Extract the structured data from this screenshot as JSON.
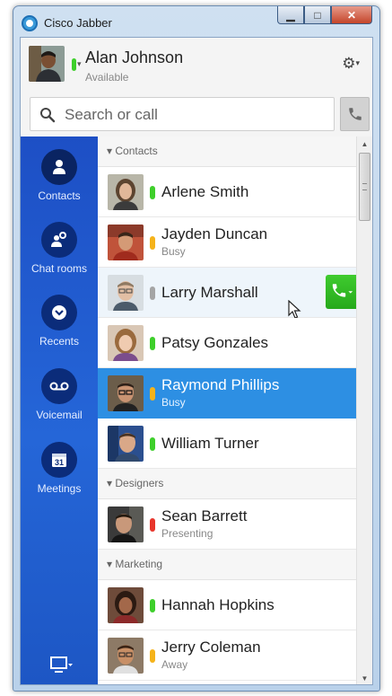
{
  "window": {
    "title": "Cisco Jabber",
    "minimize_icon": "minimize-icon",
    "maximize_icon": "maximize-icon",
    "close_icon": "close-icon"
  },
  "header": {
    "user_name": "Alan Johnson",
    "status": "Available",
    "status_color": "#3ecf2b"
  },
  "search": {
    "placeholder": "Search or call",
    "value": ""
  },
  "sidebar": {
    "items": [
      {
        "label": "Contacts",
        "icon": "person-icon"
      },
      {
        "label": "Chat rooms",
        "icon": "chat-rooms-icon"
      },
      {
        "label": "Recents",
        "icon": "recents-icon"
      },
      {
        "label": "Voicemail",
        "icon": "voicemail-icon"
      },
      {
        "label": "Meetings",
        "icon": "calendar-icon",
        "icon_text": "31"
      }
    ]
  },
  "contacts": {
    "groups": [
      {
        "name": "Contacts"
      },
      {
        "name": "Designers"
      },
      {
        "name": "Marketing"
      }
    ],
    "rows": [
      {
        "name": "Arlene Smith",
        "status": "",
        "status_color": "#3ecf2b"
      },
      {
        "name": "Jayden Duncan",
        "status": "Busy",
        "status_color": "#f5b31a"
      },
      {
        "name": "Larry Marshall",
        "status": "",
        "status_color": "#a5a5a5"
      },
      {
        "name": "Patsy Gonzales",
        "status": "",
        "status_color": "#3ecf2b"
      },
      {
        "name": "Raymond Phillips",
        "status": "Busy",
        "status_color": "#f5b31a"
      },
      {
        "name": "William Turner",
        "status": "",
        "status_color": "#3ecf2b"
      },
      {
        "name": "Sean Barrett",
        "status": "Presenting",
        "status_color": "#e8352b"
      },
      {
        "name": "Hannah Hopkins",
        "status": "",
        "status_color": "#3ecf2b"
      },
      {
        "name": "Jerry Coleman",
        "status": "Away",
        "status_color": "#f5b31a"
      }
    ]
  },
  "colors": {
    "accent": "#2d8fe3",
    "sidebar": "#2566d8",
    "call_green": "#2fb823"
  }
}
